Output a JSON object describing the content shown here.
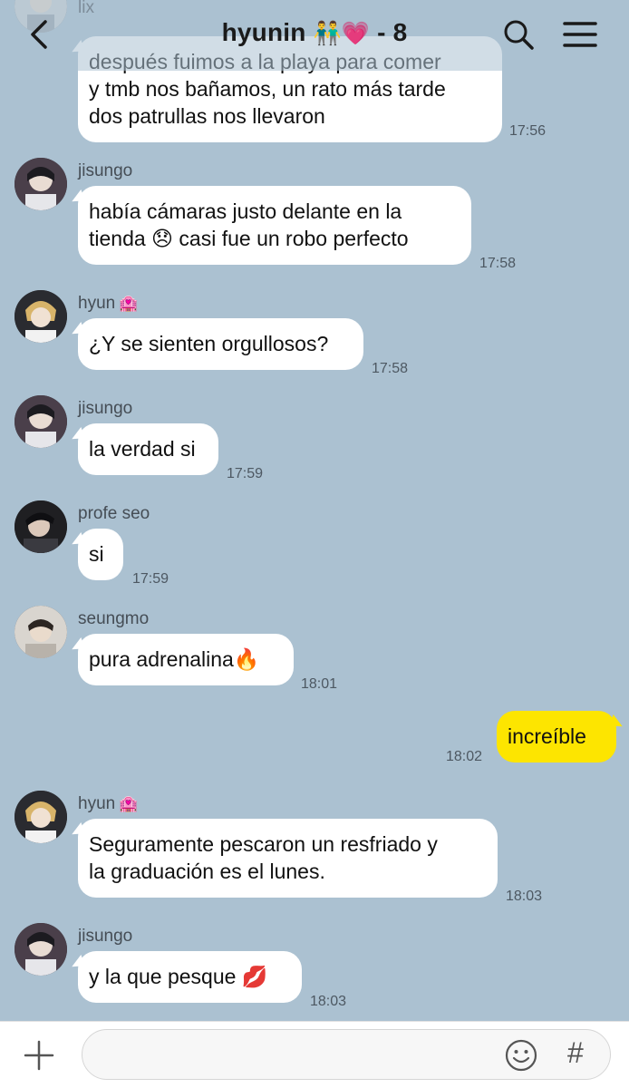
{
  "header": {
    "title": "hyunin",
    "title_emoji": "👬💗",
    "member_count": "- 8"
  },
  "messages": [
    {
      "sender": "lix",
      "text_lines": [
        "después fuimos a la playa para comer",
        "y tmb nos bañamos, un rato más tarde",
        "dos patrullas nos llevaron"
      ],
      "time": "17:56"
    },
    {
      "sender": "jisungo",
      "text_lines": [
        "había cámaras justo delante en la",
        "tienda 😞 casi fue un robo perfecto"
      ],
      "time": "17:58"
    },
    {
      "sender": "hyun",
      "sender_tag": "🏩",
      "text_lines": [
        "¿Y se sienten orgullosos?"
      ],
      "time": "17:58"
    },
    {
      "sender": "jisungo",
      "text_lines": [
        "la verdad si"
      ],
      "time": "17:59"
    },
    {
      "sender": "profe seo",
      "text_lines": [
        "si"
      ],
      "time": "17:59"
    },
    {
      "sender": "seungmo",
      "text_lines": [
        "pura adrenalina🔥"
      ],
      "time": "18:01"
    },
    {
      "sender": "me",
      "text_lines": [
        "increíble"
      ],
      "time": "18:02"
    },
    {
      "sender": "hyun",
      "sender_tag": "🏩",
      "text_lines": [
        "Seguramente pescaron un resfriado y",
        "la graduación es el lunes."
      ],
      "time": "18:03"
    },
    {
      "sender": "jisungo",
      "text_lines": [
        "y la que pesque 💋"
      ],
      "time": "18:03"
    }
  ],
  "composer": {
    "placeholder": "",
    "plus_icon": "plus-icon",
    "emoji_icon": "emoji-icon",
    "hash_label": "#"
  },
  "colors": {
    "background": "#abc1d1",
    "my_bubble": "#fde500",
    "other_bubble": "#ffffff"
  }
}
